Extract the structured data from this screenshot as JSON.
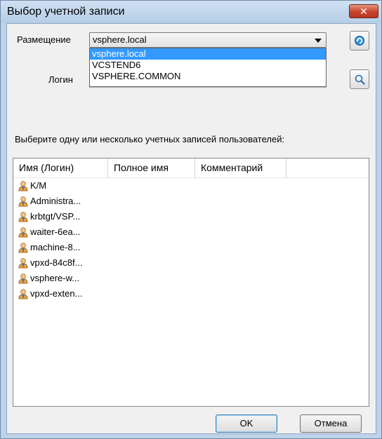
{
  "window": {
    "title": "Выбор учетной записи",
    "close_glyph": "✕"
  },
  "placement": {
    "label": "Размещение",
    "selected": "vsphere.local",
    "options": [
      "vsphere.local",
      "VCSTEND6",
      "VSPHERE.COMMON"
    ]
  },
  "login": {
    "label": "Логин",
    "value": ""
  },
  "instruction": "Выберите одну или несколько учетных записей пользователей:",
  "table": {
    "columns": [
      "Имя (Логин)",
      "Полное имя",
      "Комментарий"
    ],
    "rows": [
      {
        "name": "K/M",
        "icon": "user-icon"
      },
      {
        "name": "Administra...",
        "icon": "user-icon"
      },
      {
        "name": "krbtgt/VSP...",
        "icon": "user-icon"
      },
      {
        "name": "waiter-6ea...",
        "icon": "user-icon"
      },
      {
        "name": "machine-8...",
        "icon": "user-icon"
      },
      {
        "name": "vpxd-84c8f...",
        "icon": "user-icon"
      },
      {
        "name": "vsphere-w...",
        "icon": "user-icon"
      },
      {
        "name": "vpxd-exten...",
        "icon": "user-icon"
      }
    ]
  },
  "buttons": {
    "ok": "OK",
    "cancel": "Отмена"
  },
  "icons": {
    "refresh": "refresh-icon",
    "search": "search-icon"
  },
  "colors": {
    "selection": "#3399ff",
    "title_bg": "#bcd3ea",
    "close_red": "#c9442d"
  }
}
